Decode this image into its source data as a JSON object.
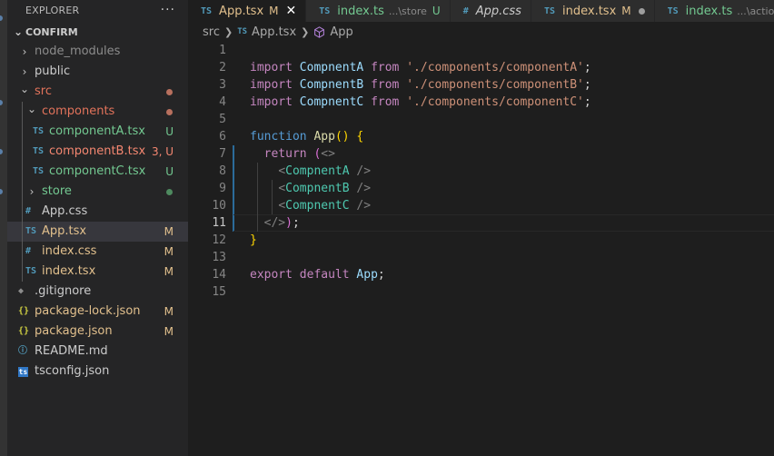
{
  "explorer": {
    "title": "EXPLORER",
    "more": "···",
    "section": "CONFIRM",
    "items": [
      {
        "name": "node_modules",
        "type": "folder",
        "open": false,
        "depth": 0,
        "color": "#8c8c8c",
        "status": "",
        "dot": ""
      },
      {
        "name": "public",
        "type": "folder",
        "open": false,
        "depth": 0,
        "color": "#cccccc",
        "status": "",
        "dot": ""
      },
      {
        "name": "src",
        "type": "folder",
        "open": true,
        "depth": 0,
        "color": "#e2735b",
        "status": "",
        "dot": "#b8705e"
      },
      {
        "name": "components",
        "type": "folder",
        "open": true,
        "depth": 1,
        "color": "#e2735b",
        "status": "",
        "dot": "#b8705e"
      },
      {
        "name": "componentA.tsx",
        "type": "ts",
        "depth": 2,
        "color": "#73c991",
        "status": "U",
        "statusColor": "#73c991",
        "dot": ""
      },
      {
        "name": "componentB.tsx",
        "type": "ts",
        "depth": 2,
        "color": "#f48771",
        "status": "3, U",
        "statusColor": "#f48771",
        "dot": ""
      },
      {
        "name": "componentC.tsx",
        "type": "ts",
        "depth": 2,
        "color": "#73c991",
        "status": "U",
        "statusColor": "#73c991",
        "dot": ""
      },
      {
        "name": "store",
        "type": "folder",
        "open": false,
        "depth": 1,
        "color": "#73c991",
        "status": "",
        "dot": "#4e8a5f"
      },
      {
        "name": "App.css",
        "type": "css",
        "depth": 1,
        "color": "#cccccc",
        "status": "",
        "dot": ""
      },
      {
        "name": "App.tsx",
        "type": "ts",
        "depth": 1,
        "color": "#e2c08d",
        "status": "M",
        "statusColor": "#e2c08d",
        "dot": "",
        "selected": true
      },
      {
        "name": "index.css",
        "type": "css",
        "depth": 1,
        "color": "#e2c08d",
        "status": "M",
        "statusColor": "#e2c08d",
        "dot": ""
      },
      {
        "name": "index.tsx",
        "type": "ts",
        "depth": 1,
        "color": "#e2c08d",
        "status": "M",
        "statusColor": "#e2c08d",
        "dot": ""
      },
      {
        "name": ".gitignore",
        "type": "git",
        "depth": 0,
        "color": "#cccccc",
        "status": "",
        "dot": ""
      },
      {
        "name": "package-lock.json",
        "type": "json",
        "depth": 0,
        "color": "#e2c08d",
        "status": "M",
        "statusColor": "#e2c08d",
        "dot": ""
      },
      {
        "name": "package.json",
        "type": "json",
        "depth": 0,
        "color": "#e2c08d",
        "status": "M",
        "statusColor": "#e2c08d",
        "dot": ""
      },
      {
        "name": "README.md",
        "type": "info",
        "depth": 0,
        "color": "#cccccc",
        "status": "",
        "dot": ""
      },
      {
        "name": "tsconfig.json",
        "type": "tsconfig",
        "depth": 0,
        "color": "#cccccc",
        "status": "",
        "dot": ""
      }
    ]
  },
  "tabs": [
    {
      "icon": "TS",
      "label": "App.tsx",
      "desc": "",
      "status": "M",
      "labelColor": "#e2c08d",
      "active": true,
      "close": "✕"
    },
    {
      "icon": "TS",
      "label": "index.ts",
      "desc": "...\\store",
      "status": "U",
      "labelColor": "#73c991",
      "active": false
    },
    {
      "icon": "#",
      "label": "App.css",
      "desc": "",
      "status": "",
      "labelColor": "#cccccc",
      "active": false,
      "italic": true
    },
    {
      "icon": "TS",
      "label": "index.tsx",
      "desc": "",
      "status": "M",
      "labelColor": "#e2c08d",
      "active": false,
      "dot": true
    },
    {
      "icon": "TS",
      "label": "index.ts",
      "desc": "...\\actio",
      "status": "",
      "labelColor": "#73c991",
      "active": false
    }
  ],
  "breadcrumb": {
    "folder": "src",
    "icon": "TS",
    "file": "App.tsx",
    "symbol": "App"
  },
  "editor": {
    "current_line": 11,
    "lines": [
      [],
      [
        [
          "kw",
          "import "
        ],
        [
          "id",
          "CompnentA "
        ],
        [
          "kw",
          "from "
        ],
        [
          "str",
          "'./components/componentA'"
        ],
        [
          "plain",
          ";"
        ]
      ],
      [
        [
          "kw",
          "import "
        ],
        [
          "id",
          "CompnentB "
        ],
        [
          "kw",
          "from "
        ],
        [
          "str",
          "'./components/componentB'"
        ],
        [
          "plain",
          ";"
        ]
      ],
      [
        [
          "kw",
          "import "
        ],
        [
          "id",
          "CompnentC "
        ],
        [
          "kw",
          "from "
        ],
        [
          "str",
          "'./components/componentC'"
        ],
        [
          "plain",
          ";"
        ]
      ],
      [],
      [
        [
          "fnk",
          "function "
        ],
        [
          "fnname",
          "App"
        ],
        [
          "brace",
          "() {"
        ]
      ],
      [
        [
          "plain",
          "  "
        ],
        [
          "kw",
          "return "
        ],
        [
          "paren",
          "("
        ],
        [
          "tagb",
          "<>"
        ]
      ],
      [
        [
          "plain",
          "    "
        ],
        [
          "tagb",
          "<"
        ],
        [
          "comp",
          "CompnentA"
        ],
        [
          "tagb",
          " />"
        ]
      ],
      [
        [
          "plain",
          "    "
        ],
        [
          "tagb",
          "<"
        ],
        [
          "comp",
          "CompnentB"
        ],
        [
          "tagb",
          " />"
        ]
      ],
      [
        [
          "plain",
          "    "
        ],
        [
          "tagb",
          "<"
        ],
        [
          "comp",
          "CompnentC"
        ],
        [
          "tagb",
          " />"
        ]
      ],
      [
        [
          "plain",
          "  "
        ],
        [
          "tagb",
          "</>"
        ],
        [
          "paren",
          ")"
        ],
        [
          "plain",
          ";"
        ]
      ],
      [
        [
          "brace",
          "}"
        ]
      ],
      [],
      [
        [
          "kw",
          "export "
        ],
        [
          "kw",
          "default "
        ],
        [
          "id",
          "App"
        ],
        [
          "plain",
          ";"
        ]
      ],
      []
    ]
  }
}
